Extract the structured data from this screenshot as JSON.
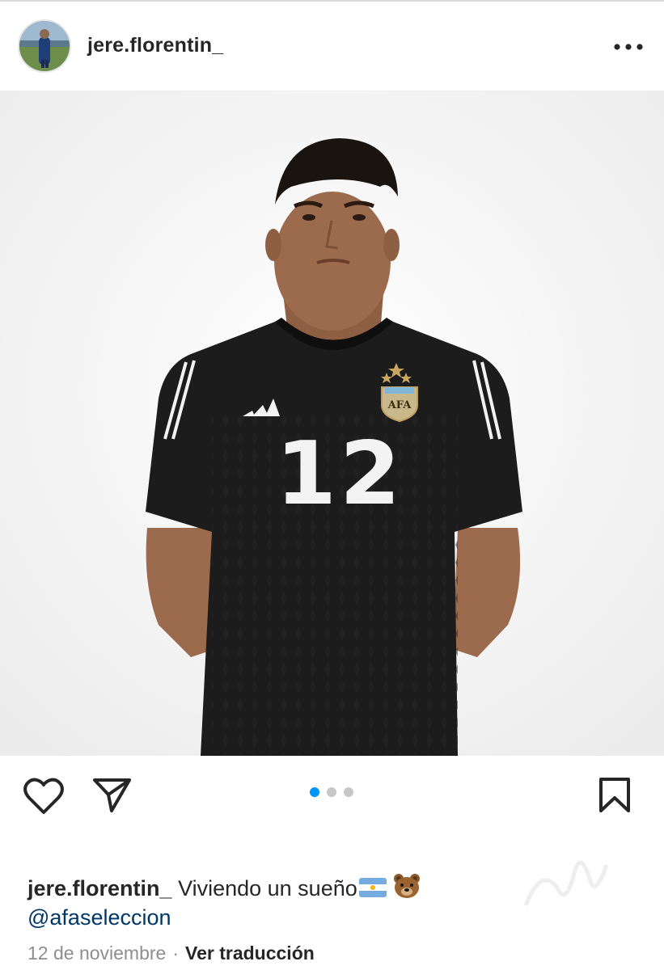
{
  "header": {
    "username": "jere.florentin_",
    "avatar_icon": "profile-avatar",
    "more_icon": "more-horizontal-icon"
  },
  "post": {
    "photo_description_icon": "player-photo",
    "jersey_number": "12",
    "jersey_crest_text": "AFA",
    "carousel": {
      "count": 3,
      "active_index": 0
    },
    "actions": {
      "like_icon": "heart-icon",
      "share_icon": "send-icon",
      "save_icon": "bookmark-icon"
    }
  },
  "caption": {
    "username": "jere.florentin_",
    "text": "Viviendo un sueño",
    "emojis": [
      "argentina-flag-icon",
      "bear-face-icon"
    ],
    "mention": "@afaseleccion"
  },
  "meta": {
    "date": "12 de noviembre",
    "separator": "·",
    "translate_label": "Ver traducción"
  },
  "colors": {
    "text": "#262626",
    "secondary": "#8e8e8e",
    "link": "#00376b",
    "accent": "#0095f6",
    "jersey": "#1c1c1c"
  }
}
